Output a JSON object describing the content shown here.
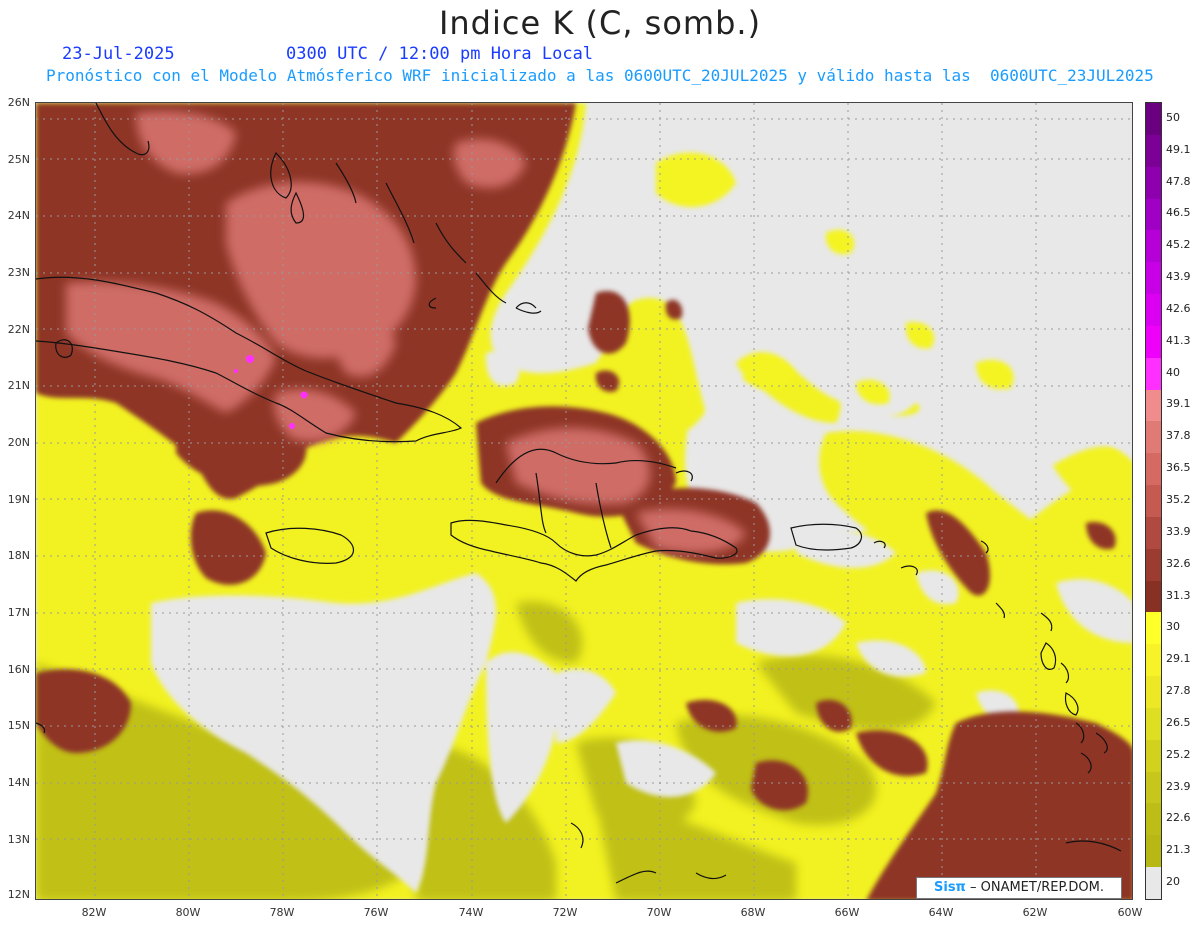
{
  "title": "Indice K (C, somb.)",
  "date": "23-Jul-2025",
  "time": "0300 UTC / 12:00 pm Hora Local",
  "forecast_note": "Pronóstico con el Modelo Atmósferico WRF inicializado a las 0600UTC_20JUL2025 y válido hasta las  0600UTC_23JUL2025",
  "credit": {
    "brand": "Sisπ",
    "rest": " – ONAMET/REP.DOM."
  },
  "lat_labels": [
    "26N",
    "25N",
    "24N",
    "23N",
    "22N",
    "21N",
    "20N",
    "19N",
    "18N",
    "17N",
    "16N",
    "15N",
    "14N",
    "13N",
    "12N"
  ],
  "lon_labels": [
    "82W",
    "80W",
    "78W",
    "76W",
    "74W",
    "72W",
    "70W",
    "68W",
    "66W",
    "64W",
    "62W",
    "60W"
  ],
  "legend": {
    "labels": [
      "50",
      "49.1",
      "47.8",
      "46.5",
      "45.2",
      "43.9",
      "42.6",
      "41.3",
      "40",
      "39.1",
      "37.8",
      "36.5",
      "35.2",
      "33.9",
      "32.6",
      "31.3",
      "30",
      "29.1",
      "27.8",
      "26.5",
      "25.2",
      "23.9",
      "22.6",
      "21.3",
      "20"
    ],
    "colors": [
      "#6a0080",
      "#7c0096",
      "#8e00ad",
      "#a000c4",
      "#b500d8",
      "#c800e6",
      "#dc00f2",
      "#ee00fa",
      "#ff30ff",
      "#f08c8c",
      "#e07a74",
      "#d46a62",
      "#c45a50",
      "#b04a40",
      "#9c3c30",
      "#883024",
      "#ffff2a",
      "#f8f228",
      "#ece826",
      "#dede22",
      "#d2d21e",
      "#c6c61c",
      "#bdbd18",
      "#b8b814",
      "#e8e8e8"
    ]
  },
  "colors": {
    "ocean_clear": "#e8e8e8",
    "yellow_bright": "#ffff22",
    "yellow_mid": "#e6e620",
    "olive": "#b8b814",
    "brown_dark": "#883024",
    "brown_mid": "#a84a40",
    "salmon": "#d2706a",
    "magenta": "#ff30ff",
    "coast": "#111111",
    "grid": "#9a9a9a"
  }
}
